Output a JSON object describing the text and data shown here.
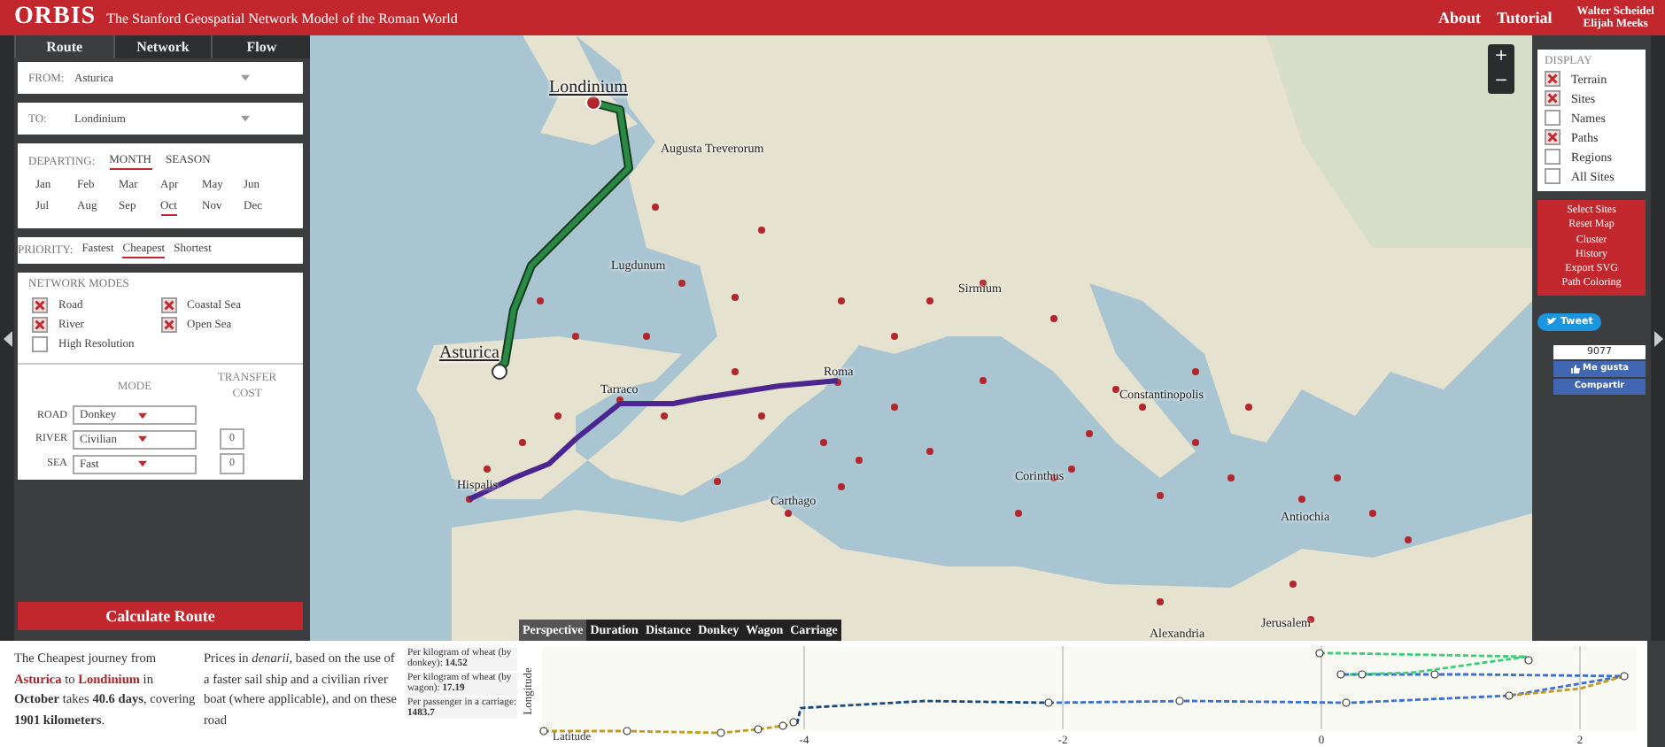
{
  "header": {
    "logo": "ORBIS",
    "subtitle": "The Stanford Geospatial Network Model of the Roman World",
    "links": [
      "About",
      "Tutorial"
    ],
    "authors": [
      "Walter Scheidel",
      "Elijah Meeks"
    ]
  },
  "tabs": [
    {
      "label": "Route",
      "selected": true
    },
    {
      "label": "Network",
      "selected": false
    },
    {
      "label": "Flow",
      "selected": false
    }
  ],
  "from": {
    "label": "FROM:",
    "value": "Asturica"
  },
  "to": {
    "label": "TO:",
    "value": "Londinium"
  },
  "departing": {
    "label": "DEPARTING:",
    "modes": [
      {
        "label": "MONTH",
        "selected": true
      },
      {
        "label": "SEASON",
        "selected": false
      }
    ],
    "months": [
      {
        "label": "Jan",
        "selected": false
      },
      {
        "label": "Feb",
        "selected": false
      },
      {
        "label": "Mar",
        "selected": false
      },
      {
        "label": "Apr",
        "selected": false
      },
      {
        "label": "May",
        "selected": false
      },
      {
        "label": "Jun",
        "selected": false
      },
      {
        "label": "Jul",
        "selected": false
      },
      {
        "label": "Aug",
        "selected": false
      },
      {
        "label": "Sep",
        "selected": false
      },
      {
        "label": "Oct",
        "selected": true
      },
      {
        "label": "Nov",
        "selected": false
      },
      {
        "label": "Dec",
        "selected": false
      }
    ]
  },
  "priority": {
    "label": "PRIORITY:",
    "options": [
      {
        "label": "Fastest",
        "selected": false
      },
      {
        "label": "Cheapest",
        "selected": true
      },
      {
        "label": "Shortest",
        "selected": false
      }
    ]
  },
  "network_modes": {
    "title": "NETWORK MODES",
    "options": [
      {
        "label": "Road",
        "checked": true
      },
      {
        "label": "Coastal Sea",
        "checked": true
      },
      {
        "label": "River",
        "checked": true
      },
      {
        "label": "Open Sea",
        "checked": true
      },
      {
        "label": "High Resolution",
        "checked": false
      }
    ]
  },
  "mode_settings": {
    "mode_heading": "MODE",
    "cost_heading": "TRANSFER COST",
    "rows": [
      {
        "label": "ROAD",
        "value": "Donkey"
      },
      {
        "label": "RIVER",
        "value": "Civilian",
        "cost": "0"
      },
      {
        "label": "SEA",
        "value": "Fast",
        "cost": "0"
      }
    ]
  },
  "calculate_button": "Calculate Route",
  "map": {
    "zoom": [
      "+",
      "−"
    ],
    "places": [
      {
        "name": "Londinium",
        "kind": "endpoint"
      },
      {
        "name": "Augusta Treverorum",
        "kind": "site"
      },
      {
        "name": "Lugdunum",
        "kind": "site"
      },
      {
        "name": "Sirmium",
        "kind": "site"
      },
      {
        "name": "Asturica",
        "kind": "endpoint"
      },
      {
        "name": "Tarraco",
        "kind": "site"
      },
      {
        "name": "Roma",
        "kind": "site"
      },
      {
        "name": "Constantinopolis",
        "kind": "site"
      },
      {
        "name": "Hispalis",
        "kind": "site"
      },
      {
        "name": "Corinthus",
        "kind": "site"
      },
      {
        "name": "Carthago",
        "kind": "site"
      },
      {
        "name": "Antiochia",
        "kind": "site"
      },
      {
        "name": "Alexandria",
        "kind": "site"
      },
      {
        "name": "Jerusalem",
        "kind": "site"
      }
    ]
  },
  "display": {
    "title": "DISPLAY",
    "options": [
      {
        "label": "Terrain",
        "checked": true
      },
      {
        "label": "Sites",
        "checked": true
      },
      {
        "label": "Names",
        "checked": false
      },
      {
        "label": "Paths",
        "checked": true
      },
      {
        "label": "Regions",
        "checked": false
      },
      {
        "label": "All Sites",
        "checked": false
      }
    ]
  },
  "actions": [
    "Select Sites",
    "Reset Map",
    "Cluster",
    "History",
    "Export SVG",
    "Path Coloring"
  ],
  "social": {
    "tweet": "Tweet",
    "like_count": "9077",
    "like": "Me gusta",
    "share": "Compartir"
  },
  "summary": "The Cheapest journey from **Asturica** to **Londinium** in **October** takes **40.6 days**, covering **1901 kilometers**.",
  "prices": "Prices in *denarii*, based on the use of a faster sail ship and a civilian river boat (where applicable), and on these road",
  "price_notes": [
    "Per kilogram of wheat (by donkey): **14.52**",
    "Per kilogram of wheat (by wagon): **17.19**",
    "Per passenger in a carriage: **1483.7**"
  ],
  "chart": {
    "tabs": [
      {
        "label": "Perspective",
        "selected": true
      },
      {
        "label": "Duration",
        "selected": false
      },
      {
        "label": "Distance",
        "selected": false
      },
      {
        "label": "Donkey",
        "selected": false
      },
      {
        "label": "Wagon",
        "selected": false
      },
      {
        "label": "Carriage",
        "selected": false
      }
    ],
    "ylabel": "Longitude",
    "xlabel": "Latitude",
    "xticks": [
      "-4",
      "-2",
      "0",
      "2"
    ]
  }
}
